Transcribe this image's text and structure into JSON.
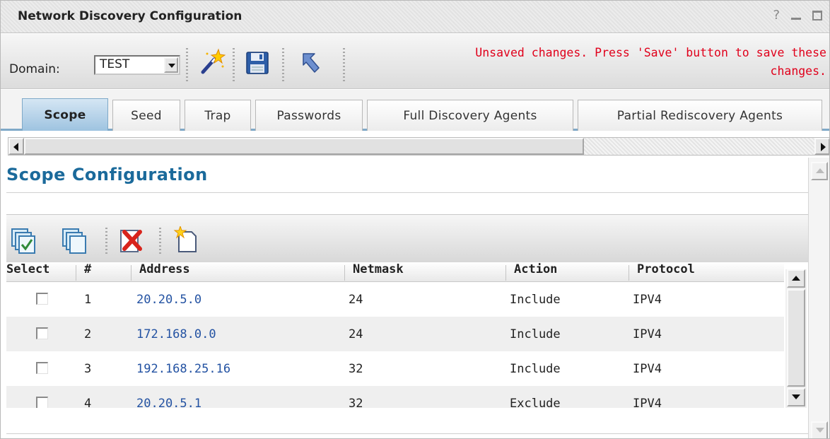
{
  "window": {
    "title": "Network Discovery Configuration",
    "help_label": "?"
  },
  "toolbar": {
    "domain_label": "Domain:",
    "domain_value": "TEST",
    "icons": [
      "wand-icon",
      "save-icon",
      "undo-arrow-icon"
    ],
    "unsaved_line1": "Unsaved changes. Press 'Save' button to save these",
    "unsaved_line2": "changes."
  },
  "tabs": [
    {
      "label": "Scope",
      "active": true
    },
    {
      "label": "Seed",
      "active": false
    },
    {
      "label": "Trap",
      "active": false
    },
    {
      "label": "Passwords",
      "active": false
    },
    {
      "label": "Full Discovery Agents",
      "active": false
    },
    {
      "label": "Partial Rediscovery Agents",
      "active": false
    }
  ],
  "section": {
    "title": "Scope Configuration"
  },
  "grid_toolbar": {
    "icons": [
      "select-all-icon",
      "deselect-all-icon",
      "delete-icon",
      "new-icon"
    ]
  },
  "table": {
    "columns": [
      "Select",
      "#",
      "Address",
      "Netmask",
      "Action",
      "Protocol"
    ],
    "rows": [
      {
        "num": "1",
        "address": "20.20.5.0",
        "netmask": "24",
        "action": "Include",
        "protocol": "IPV4"
      },
      {
        "num": "2",
        "address": "172.168.0.0",
        "netmask": "24",
        "action": "Include",
        "protocol": "IPV4"
      },
      {
        "num": "3",
        "address": "192.168.25.16",
        "netmask": "32",
        "action": "Include",
        "protocol": "IPV4"
      },
      {
        "num": "4",
        "address": "20.20.5.1",
        "netmask": "32",
        "action": "Exclude",
        "protocol": "IPV4"
      }
    ]
  },
  "colors": {
    "accent": "#1b6a9b",
    "link": "#2352a2",
    "warning": "#e0001b"
  }
}
